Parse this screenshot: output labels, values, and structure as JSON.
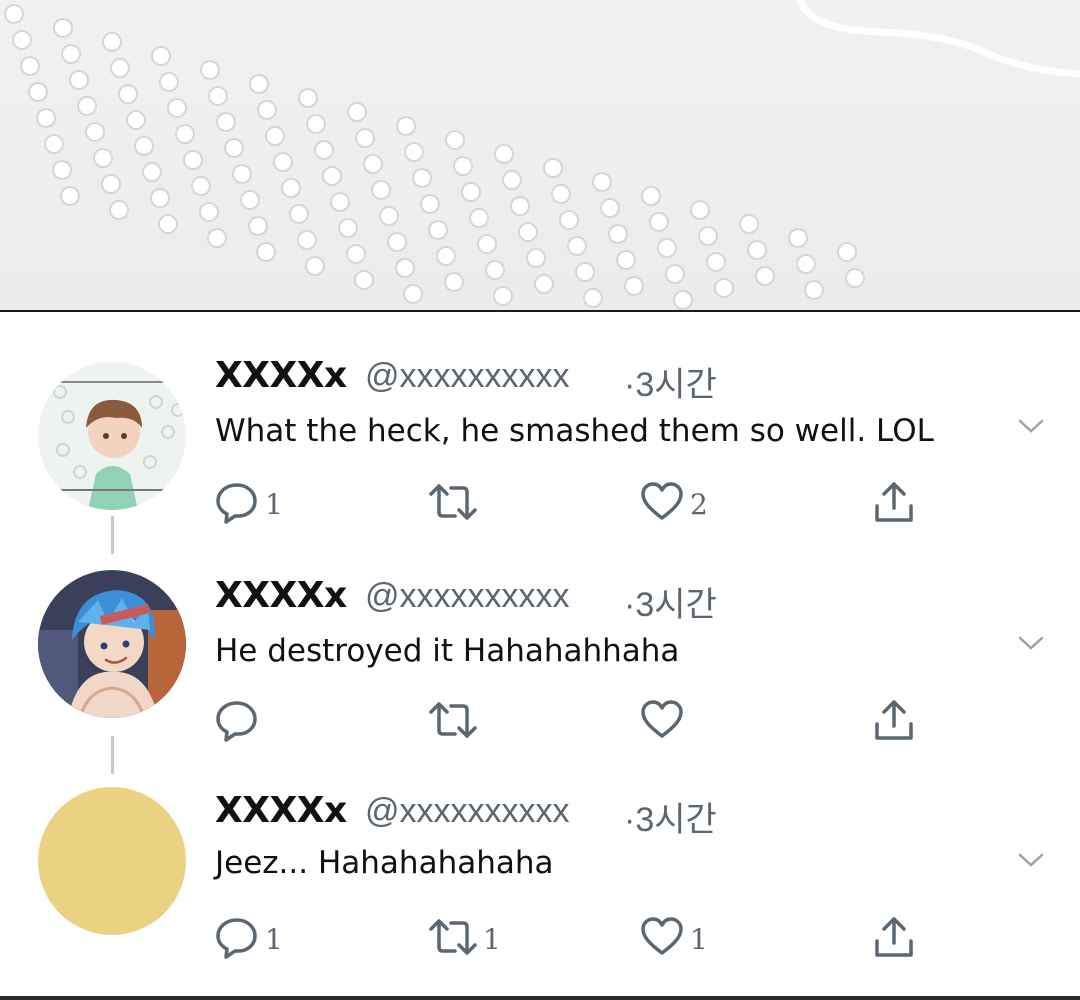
{
  "tweets": [
    {
      "name": "XXXXx",
      "handle": "@xxxxxxxxxx",
      "time": "·3시간",
      "text": "What the heck, he smashed them so well. LOL",
      "reply_count": "1",
      "retweet_count": "",
      "like_count": "2",
      "avatar": "anime-boy-brown-hair-avatar"
    },
    {
      "name": "XXXXx",
      "handle": "@xxxxxxxxxx",
      "time": "·3시간",
      "text": "He destroyed it Hahahahhaha",
      "reply_count": "",
      "retweet_count": "",
      "like_count": "",
      "avatar": "anime-boy-blue-hair-avatar"
    },
    {
      "name": "XXXXx",
      "handle": "@xxxxxxxxxx",
      "time": "·3시간",
      "text": "Jeez... Hahahahahaha",
      "reply_count": "1",
      "retweet_count": "1",
      "like_count": "1",
      "avatar": "plain-yellow-avatar"
    }
  ],
  "colors": {
    "icon_gray": "#5b6670",
    "text": "#111111",
    "banner": "#efefef",
    "yellow_avatar": "#ebd283"
  }
}
